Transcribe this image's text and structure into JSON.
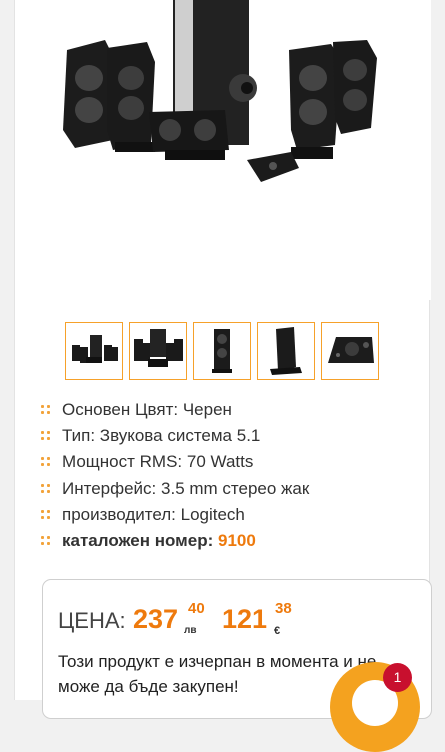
{
  "gallery": {
    "thumbnails": [
      {
        "name": "thumb-full-set"
      },
      {
        "name": "thumb-front-set"
      },
      {
        "name": "thumb-satellite-front"
      },
      {
        "name": "thumb-satellite-side"
      },
      {
        "name": "thumb-control-pod"
      }
    ]
  },
  "specs": [
    {
      "key": "Основен Цвят:",
      "value": "Черен"
    },
    {
      "key": "Тип:",
      "value": "Звукова система 5.1"
    },
    {
      "key": "Мощност RMS:",
      "value": "70 Watts"
    },
    {
      "key": "Интерфейс:",
      "value": "3.5 mm стерео жак"
    },
    {
      "key": "производител:",
      "value": "Logitech"
    },
    {
      "key": "каталожен номер:",
      "value": "9100"
    }
  ],
  "price": {
    "label": "ЦЕНА:",
    "bgn_int": "237",
    "bgn_dec": "40",
    "bgn_currency": "лв",
    "eur_int": "121",
    "eur_dec": "38",
    "eur_currency": "€",
    "notice": "Този продукт е изчерпан в момента и не може да бъде закупен!"
  },
  "cart": {
    "badge_count": "1"
  },
  "colors": {
    "accent": "#ee7a0d",
    "bullet": "#f2a33a",
    "badge": "#c8102e",
    "fab": "#f4a21f"
  }
}
